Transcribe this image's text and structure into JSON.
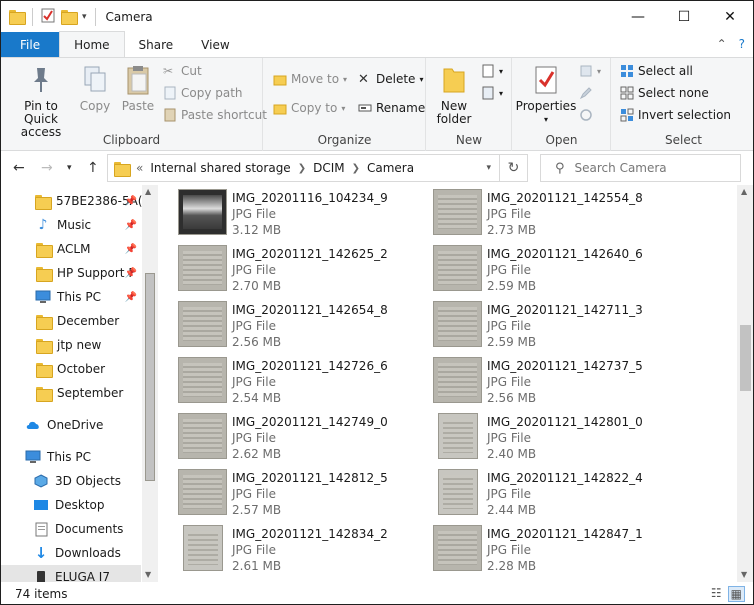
{
  "window": {
    "title": "Camera",
    "controls": {
      "minimize": "—",
      "maximize": "☐",
      "close": "✕"
    }
  },
  "ribbon_tabs": [
    {
      "label": "File"
    },
    {
      "label": "Home"
    },
    {
      "label": "Share"
    },
    {
      "label": "View"
    }
  ],
  "ribbon": {
    "clipboard": {
      "label": "Clipboard",
      "pin": "Pin to Quick access",
      "copy": "Copy",
      "paste": "Paste",
      "cut": "Cut",
      "copy_path": "Copy path",
      "paste_shortcut": "Paste shortcut"
    },
    "organize": {
      "label": "Organize",
      "move_to": "Move to",
      "copy_to": "Copy to",
      "delete": "Delete",
      "rename": "Rename"
    },
    "new": {
      "label": "New",
      "new_folder": "New folder"
    },
    "open": {
      "label": "Open",
      "properties": "Properties"
    },
    "select": {
      "label": "Select",
      "select_all": "Select all",
      "select_none": "Select none",
      "invert": "Invert selection"
    }
  },
  "address": {
    "overflow": "«",
    "crumbs": [
      "Internal shared storage",
      "DCIM",
      "Camera"
    ]
  },
  "search": {
    "placeholder": "Search Camera"
  },
  "nav": {
    "items": [
      {
        "label": "57BE2386-5A(",
        "icon": "folder-icon",
        "pinned": true
      },
      {
        "label": "Music",
        "icon": "music-icon",
        "pinned": true
      },
      {
        "label": "ACLM",
        "icon": "folder-icon",
        "pinned": true
      },
      {
        "label": "HP Support F",
        "icon": "folder-icon",
        "pinned": true
      },
      {
        "label": "This PC",
        "icon": "monitor-icon",
        "pinned": true
      },
      {
        "label": "December",
        "icon": "folder-icon",
        "pinned": false
      },
      {
        "label": "jtp new",
        "icon": "folder-icon",
        "pinned": false
      },
      {
        "label": "October",
        "icon": "folder-icon",
        "pinned": false
      },
      {
        "label": "September",
        "icon": "folder-icon",
        "pinned": false
      },
      {
        "label": "OneDrive",
        "icon": "cloud-icon",
        "pinned": false
      },
      {
        "label": "This PC",
        "icon": "monitor-icon",
        "pinned": false
      },
      {
        "label": "3D Objects",
        "icon": "cube-icon",
        "pinned": false
      },
      {
        "label": "Desktop",
        "icon": "desktop-icon",
        "pinned": false
      },
      {
        "label": "Documents",
        "icon": "documents-icon",
        "pinned": false
      },
      {
        "label": "Downloads",
        "icon": "download-icon",
        "pinned": false
      },
      {
        "label": "ELUGA I7",
        "icon": "phone-icon",
        "pinned": false
      }
    ]
  },
  "files": [
    {
      "name": "IMG_20201116_104234_9",
      "type": "JPG File",
      "size": "3.12 MB",
      "thumb": "dark"
    },
    {
      "name": "IMG_20201121_142554_8",
      "type": "JPG File",
      "size": "2.73 MB",
      "thumb": "wide"
    },
    {
      "name": "IMG_20201121_142625_2",
      "type": "JPG File",
      "size": "2.70 MB",
      "thumb": "wide"
    },
    {
      "name": "IMG_20201121_142640_6",
      "type": "JPG File",
      "size": "2.59 MB",
      "thumb": "wide"
    },
    {
      "name": "IMG_20201121_142654_8",
      "type": "JPG File",
      "size": "2.56 MB",
      "thumb": "wide"
    },
    {
      "name": "IMG_20201121_142711_3",
      "type": "JPG File",
      "size": "2.59 MB",
      "thumb": "wide"
    },
    {
      "name": "IMG_20201121_142726_6",
      "type": "JPG File",
      "size": "2.54 MB",
      "thumb": "wide"
    },
    {
      "name": "IMG_20201121_142737_5",
      "type": "JPG File",
      "size": "2.56 MB",
      "thumb": "wide"
    },
    {
      "name": "IMG_20201121_142749_0",
      "type": "JPG File",
      "size": "2.62 MB",
      "thumb": "wide"
    },
    {
      "name": "IMG_20201121_142801_0",
      "type": "JPG File",
      "size": "2.40 MB",
      "thumb": "tall"
    },
    {
      "name": "IMG_20201121_142812_5",
      "type": "JPG File",
      "size": "2.57 MB",
      "thumb": "wide"
    },
    {
      "name": "IMG_20201121_142822_4",
      "type": "JPG File",
      "size": "2.44 MB",
      "thumb": "tall"
    },
    {
      "name": "IMG_20201121_142834_2",
      "type": "JPG File",
      "size": "2.61 MB",
      "thumb": "tall"
    },
    {
      "name": "IMG_20201121_142847_1",
      "type": "JPG File",
      "size": "2.28 MB",
      "thumb": "wide"
    }
  ],
  "status": {
    "item_count": "74 items"
  }
}
